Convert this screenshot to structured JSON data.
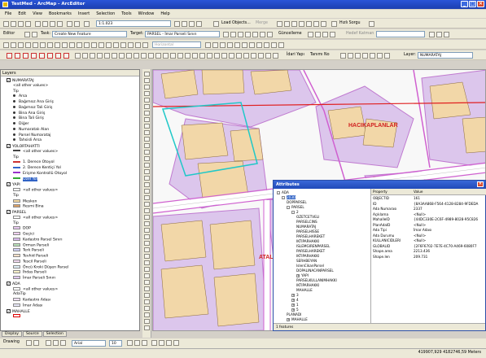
{
  "window": {
    "title": "TestMed - ArcMap - ArcEditor",
    "minimize": "_",
    "maximize": "□",
    "close": "×"
  },
  "menu": [
    "File",
    "Edit",
    "View",
    "Bookmarks",
    "Insert",
    "Selection",
    "Tools",
    "Window",
    "Help"
  ],
  "toolbar1": {
    "scale": "1:1.023",
    "load_objects": "Load Objects...",
    "load_objects_2": "Merge",
    "hizli_sorgu": "Hızlı Sorgu"
  },
  "toolbar2": {
    "editor": "Editor",
    "task_label": "Task:",
    "task": "Create New Feature",
    "target_label": "Target:",
    "target": "PARSEL - İmar Parseli Sınırı",
    "guncelleme": "Güncelleme",
    "hedef_katman": "Hedef Katman"
  },
  "toolbar3": {
    "idari_yapi": "İdari Yapı",
    "tanimi_no": "Tanımı No",
    "layer_label": "Layer:",
    "layer": "NUMARATAJ",
    "orientation": "Horizontal"
  },
  "toc": {
    "title": "Layers",
    "items": [
      {
        "text": "Layers",
        "indent": 0,
        "bold": true,
        "check": false,
        "swatch": ""
      },
      {
        "text": "NUMARATAJ",
        "indent": 1,
        "check": true,
        "swatch": ""
      },
      {
        "text": "<all other values>",
        "indent": 3,
        "swatch": ""
      },
      {
        "text": "Tip",
        "indent": 3,
        "swatch": ""
      },
      {
        "text": "Arsa",
        "indent": 3,
        "dot": true
      },
      {
        "text": "Bağımsız Ana Giriş",
        "indent": 3,
        "dot": true
      },
      {
        "text": "Bağımsız Tali Giriş",
        "indent": 3,
        "dot": true
      },
      {
        "text": "Bina Ana Giriş",
        "indent": 3,
        "dot": true
      },
      {
        "text": "Bina Tali Giriş",
        "indent": 3,
        "dot": true
      },
      {
        "text": "Diğer",
        "indent": 3,
        "dot": true
      },
      {
        "text": "Numaratalı Alan",
        "indent": 3,
        "dot": true
      },
      {
        "text": "Parsel Numarataj",
        "indent": 3,
        "dot": true
      },
      {
        "text": "Tahsisli Arsa",
        "indent": 3,
        "dot": true
      },
      {
        "text": "YOLORTAHATTI",
        "indent": 1,
        "check": true,
        "swatch": ""
      },
      {
        "text": "<all other values>",
        "indent": 3,
        "line": "#444"
      },
      {
        "text": "Tip",
        "indent": 3,
        "swatch": ""
      },
      {
        "text": "1. Derece Otoyol",
        "indent": 3,
        "line": "#cc3333"
      },
      {
        "text": "2. Derece Kentiçi Yol",
        "indent": 3,
        "line": "#3366cc"
      },
      {
        "text": "Erişme Kontrollü Otoyol",
        "indent": 3,
        "line": "#9933cc"
      },
      {
        "text": "Özel Yol",
        "indent": 3,
        "line": "#33aa33",
        "highlight": true
      },
      {
        "text": "YAPI",
        "indent": 1,
        "check": true,
        "swatch": ""
      },
      {
        "text": "<all other values>",
        "indent": 3,
        "swatch": "#ffffff"
      },
      {
        "text": "Tip",
        "indent": 3,
        "swatch": ""
      },
      {
        "text": "Mesken",
        "indent": 3,
        "swatch": "#f4d9a0"
      },
      {
        "text": "Resmi Bina",
        "indent": 3,
        "swatch": "#d9a066"
      },
      {
        "text": "PARSEL",
        "indent": 1,
        "check": true,
        "swatch": ""
      },
      {
        "text": "<all other values>",
        "indent": 3,
        "swatch": "#ffffff"
      },
      {
        "text": "Tip",
        "indent": 3,
        "swatch": ""
      },
      {
        "text": "DOP",
        "indent": 3,
        "swatch": "#e8c8f0"
      },
      {
        "text": "Geçici",
        "indent": 3,
        "swatch": "#f0d0f0"
      },
      {
        "text": "Kadastro Parsel Sınırı",
        "indent": 3,
        "swatch": "#d8b8ec"
      },
      {
        "text": "Orman Parseli",
        "indent": 3,
        "swatch": "#b8e0b8"
      },
      {
        "text": "Terk Parseli",
        "indent": 3,
        "swatch": "#d0d0f8"
      },
      {
        "text": "Tevhid Parseli",
        "indent": 3,
        "swatch": "#f8e0c8"
      },
      {
        "text": "Tescil Parseli",
        "indent": 3,
        "swatch": "#f0d8f0"
      },
      {
        "text": "Öncü Kroki Düşen Parsel",
        "indent": 3,
        "swatch": "#e0f0f8"
      },
      {
        "text": "İhdas Parseli",
        "indent": 3,
        "swatch": "#f8f0c8"
      },
      {
        "text": "İmar Parseli Sınırı",
        "indent": 3,
        "swatch": "#e0c8f0"
      },
      {
        "text": "ADA",
        "indent": 1,
        "check": true,
        "swatch": ""
      },
      {
        "text": "<all other values>",
        "indent": 3,
        "swatch": "#ffffff"
      },
      {
        "text": "AdaTip",
        "indent": 3,
        "swatch": ""
      },
      {
        "text": "Kadastro Adası",
        "indent": 3,
        "swatch": "#f0e0f8"
      },
      {
        "text": "İmar Adası",
        "indent": 3,
        "swatch": "#e8e8f8"
      },
      {
        "text": "MAHALLE",
        "indent": 1,
        "check": true,
        "swatch": ""
      },
      {
        "text": "",
        "indent": 3,
        "swatch": "#ffffff",
        "red": true
      }
    ]
  },
  "toc_tabs": [
    "Display",
    "Source",
    "Selection"
  ],
  "map_labels": {
    "l1": "HACIKAPLANLAR",
    "l2": "ATALA"
  },
  "attributes": {
    "title": "Attributes",
    "tree": [
      {
        "text": "ADA",
        "indent": 0,
        "exp": "-"
      },
      {
        "text": "2030",
        "indent": 1,
        "exp": "-",
        "sel": true
      },
      {
        "text": "DOPPARSEL",
        "indent": 2
      },
      {
        "text": "PARSEL",
        "indent": 2,
        "exp": "-"
      },
      {
        "text": "2",
        "indent": 3,
        "exp": "-"
      },
      {
        "text": "OZETCETVELI",
        "indent": 4
      },
      {
        "text": "PARSELCINS",
        "indent": 4
      },
      {
        "text": "NUMARATAJ",
        "indent": 4
      },
      {
        "text": "PARSELHISSE",
        "indent": 4
      },
      {
        "text": "PARSELHAREKET",
        "indent": 4
      },
      {
        "text": "IKTIPARHAKKI",
        "indent": 4
      },
      {
        "text": "ISLEMGIRENPARSEL",
        "indent": 4
      },
      {
        "text": "PARSELHAREKET",
        "indent": 4
      },
      {
        "text": "IKTIPARHAKKI",
        "indent": 4
      },
      {
        "text": "SERHBEYAN",
        "indent": 4
      },
      {
        "text": "IslenCikanParsel",
        "indent": 4
      },
      {
        "text": "DOPALINACANPARSEL",
        "indent": 4
      },
      {
        "text": "YAPI",
        "indent": 4,
        "exp": "+"
      },
      {
        "text": "PARSELKULLANIMHAKKI",
        "indent": 4
      },
      {
        "text": "IKTIPARHAKKI",
        "indent": 4
      },
      {
        "text": "MAHALLE",
        "indent": 4
      },
      {
        "text": "3",
        "indent": 3,
        "exp": "+"
      },
      {
        "text": "4",
        "indent": 3,
        "exp": "+"
      },
      {
        "text": "1",
        "indent": 3,
        "exp": "+"
      },
      {
        "text": "5",
        "indent": 3,
        "exp": "+"
      },
      {
        "text": "PLANADI",
        "indent": 2
      },
      {
        "text": "MAHALLE",
        "indent": 2,
        "exp": "+"
      }
    ],
    "header": {
      "prop": "Property",
      "val": "Value"
    },
    "rows": [
      {
        "p": "OBJECTID",
        "v": "161"
      },
      {
        "p": "ID",
        "v": "{8A3AA868-F564-4128-8284-9FDEDA"
      },
      {
        "p": "Ada Numarası",
        "v": "2337"
      },
      {
        "p": "Açıklama",
        "v": "<Null>"
      },
      {
        "p": "MahalleID",
        "v": "{44DC330E-2C6F-4989-8028-95C826"
      },
      {
        "p": "PlanAdaID",
        "v": "<Null>"
      },
      {
        "p": "Ada Tipi",
        "v": "İmar Adası"
      },
      {
        "p": "Ada Durumu",
        "v": "<Null>"
      },
      {
        "p": "KULLANICIDLERI",
        "v": "<Null>"
      },
      {
        "p": "GLOBALID",
        "v": "{2F6F6702-7E7E-4C70-A469-6080F7"
      },
      {
        "p": "Shape.area",
        "v": "2213.436"
      },
      {
        "p": "Shape.len",
        "v": "209.731"
      }
    ],
    "footer": "1 features"
  },
  "status": {
    "coords": "419907,929 4182746,59 Meters",
    "drawing": "Drawing",
    "font": "Arial",
    "size": "10"
  }
}
